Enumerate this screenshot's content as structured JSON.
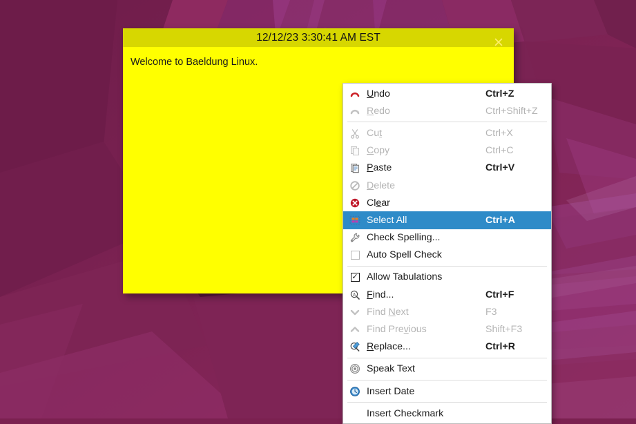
{
  "desktop": {
    "wallpaper_name": "ubuntu-lowpoly-wallpaper",
    "base_color": "#7d2253"
  },
  "editor_window": {
    "title": "12/12/23 3:30:41 AM EST",
    "body_text": "Welcome to Baeldung Linux.",
    "close_label": "×",
    "titlebar_color": "#d7d700",
    "body_color": "#ffff00"
  },
  "context_menu": {
    "highlight_color": "#2e8bc8",
    "items": [
      {
        "type": "item",
        "name": "undo",
        "icon": "undo-icon",
        "label_pre": "",
        "label_key": "U",
        "label_post": "ndo",
        "accel": "Ctrl+Z",
        "disabled": false,
        "selected": false
      },
      {
        "type": "item",
        "name": "redo",
        "icon": "redo-icon",
        "label_pre": "",
        "label_key": "R",
        "label_post": "edo",
        "accel": "Ctrl+Shift+Z",
        "disabled": true,
        "selected": false
      },
      {
        "type": "separator",
        "name": "separator-1"
      },
      {
        "type": "item",
        "name": "cut",
        "icon": "scissors-icon",
        "label_pre": "Cu",
        "label_key": "t",
        "label_post": "",
        "accel": "Ctrl+X",
        "disabled": true,
        "selected": false
      },
      {
        "type": "item",
        "name": "copy",
        "icon": "copy-icon",
        "label_pre": "",
        "label_key": "C",
        "label_post": "opy",
        "accel": "Ctrl+C",
        "disabled": true,
        "selected": false
      },
      {
        "type": "item",
        "name": "paste",
        "icon": "paste-icon",
        "label_pre": "",
        "label_key": "P",
        "label_post": "aste",
        "accel": "Ctrl+V",
        "disabled": false,
        "selected": false
      },
      {
        "type": "item",
        "name": "delete",
        "icon": "delete-icon",
        "label_pre": "",
        "label_key": "D",
        "label_post": "elete",
        "accel": "",
        "disabled": true,
        "selected": false
      },
      {
        "type": "item",
        "name": "clear",
        "icon": "clear-icon",
        "label_pre": "Cl",
        "label_key": "e",
        "label_post": "ar",
        "accel": "",
        "disabled": false,
        "selected": false
      },
      {
        "type": "item",
        "name": "select-all",
        "icon": "select-all-icon",
        "label_pre": "Select All",
        "label_key": "",
        "label_post": "",
        "accel": "Ctrl+A",
        "disabled": false,
        "selected": true
      },
      {
        "type": "item",
        "name": "check-spelling",
        "icon": "wrench-icon",
        "label_pre": "Check Spelling...",
        "label_key": "",
        "label_post": "",
        "accel": "",
        "disabled": false,
        "selected": false
      },
      {
        "type": "checkbox",
        "name": "auto-spell-check",
        "icon": "checkbox-unchecked-icon",
        "label_pre": "Auto Spell Check",
        "label_key": "",
        "label_post": "",
        "accel": "",
        "disabled": false,
        "selected": false,
        "checked": false
      },
      {
        "type": "separator",
        "name": "separator-2"
      },
      {
        "type": "checkbox",
        "name": "allow-tabulations",
        "icon": "checkbox-checked-icon",
        "label_pre": "Allow Tabulations",
        "label_key": "",
        "label_post": "",
        "accel": "",
        "disabled": false,
        "selected": false,
        "checked": true
      },
      {
        "type": "item",
        "name": "find",
        "icon": "find-icon",
        "label_pre": "",
        "label_key": "F",
        "label_post": "ind...",
        "accel": "Ctrl+F",
        "disabled": false,
        "selected": false
      },
      {
        "type": "item",
        "name": "find-next",
        "icon": "chevron-down-icon",
        "label_pre": "Find ",
        "label_key": "N",
        "label_post": "ext",
        "accel": "F3",
        "disabled": true,
        "selected": false
      },
      {
        "type": "item",
        "name": "find-previous",
        "icon": "chevron-up-icon",
        "label_pre": "Find Pre",
        "label_key": "v",
        "label_post": "ious",
        "accel": "Shift+F3",
        "disabled": true,
        "selected": false
      },
      {
        "type": "item",
        "name": "replace",
        "icon": "replace-icon",
        "label_pre": "",
        "label_key": "R",
        "label_post": "eplace...",
        "accel": "Ctrl+R",
        "disabled": false,
        "selected": false
      },
      {
        "type": "separator",
        "name": "separator-3"
      },
      {
        "type": "item",
        "name": "speak-text",
        "icon": "speaker-icon",
        "label_pre": "Speak Text",
        "label_key": "",
        "label_post": "",
        "accel": "",
        "disabled": false,
        "selected": false
      },
      {
        "type": "separator",
        "name": "separator-4"
      },
      {
        "type": "item",
        "name": "insert-date",
        "icon": "clock-icon",
        "label_pre": "Insert Date",
        "label_key": "",
        "label_post": "",
        "accel": "",
        "disabled": false,
        "selected": false
      },
      {
        "type": "separator",
        "name": "separator-5"
      },
      {
        "type": "item",
        "name": "insert-checkmark",
        "icon": "none",
        "label_pre": "Insert Checkmark",
        "label_key": "",
        "label_post": "",
        "accel": "",
        "disabled": false,
        "selected": false
      }
    ]
  }
}
